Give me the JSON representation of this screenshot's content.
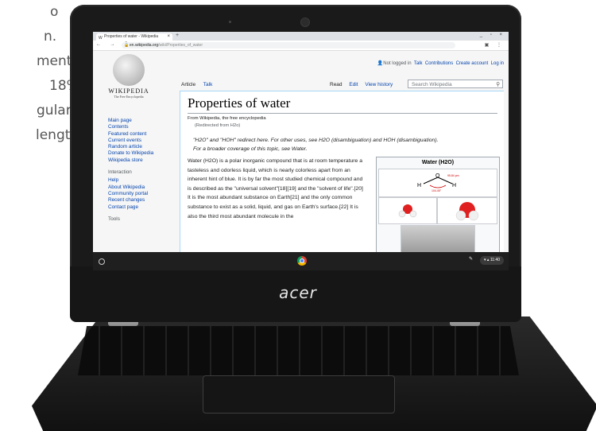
{
  "background_text": [
    "o",
    "n.",
    "ments",
    "18%",
    "gular",
    "length"
  ],
  "laptop_brand": "acer",
  "browser": {
    "tab_title": "Properties of water - Wikipedia",
    "tab_close": "×",
    "new_tab": "+",
    "window_controls": "_ ▫ ×",
    "nav_icons": "← → C",
    "url_host": "en.wikipedia.org",
    "url_path": "/wiki/Properties_of_water",
    "toolbar_icons": "▣ ⋮"
  },
  "wiki": {
    "wordmark": "WIKIPEDIA",
    "tagline": "The Free Encyclopedia",
    "user_links": [
      "Not logged in",
      "Talk",
      "Contributions",
      "Create account",
      "Log in"
    ],
    "tabs_left": [
      "Article",
      "Talk"
    ],
    "tabs_right": [
      "Read",
      "Edit",
      "View history"
    ],
    "search_placeholder": "Search Wikipedia",
    "sidebar_main": [
      "Main page",
      "Contents",
      "Featured content",
      "Current events",
      "Random article",
      "Donate to Wikipedia",
      "Wikipedia store"
    ],
    "sidebar_interaction_heading": "Interaction",
    "sidebar_interaction": [
      "Help",
      "About Wikipedia",
      "Community portal",
      "Recent changes",
      "Contact page"
    ],
    "sidebar_tools_heading": "Tools",
    "title": "Properties of water",
    "from": "From Wikipedia, the free encyclopedia",
    "redirected": "(Redirected from H2o)",
    "hatnote_1": "\"H2O\" and \"HOH\" redirect here. For other uses, see H2O (disambiguation) and HOH (disambiguation).",
    "hatnote_2": "For a broader coverage of this topic, see Water.",
    "body": "Water (H2O) is a polar inorganic compound that is at room temperature a tasteless and odorless liquid, which is nearly colorless apart from an inherent hint of blue. It is by far the most studied chemical compound and is described as the \"universal solvent\"[18][19] and the \"solvent of life\".[20] It is the most abundant substance on Earth[21] and the only common substance to exist as a solid, liquid, and gas on Earth's surface.[22] It is also the third most abundant molecule in the",
    "infobox_title": "Water (H2O)",
    "infobox_angle": "104.45°",
    "infobox_length": "95.84 pm",
    "atom_h": "H",
    "atom_o": "O"
  },
  "shelf": {
    "time": "11:40",
    "tray_icons": "▾ ▴"
  }
}
